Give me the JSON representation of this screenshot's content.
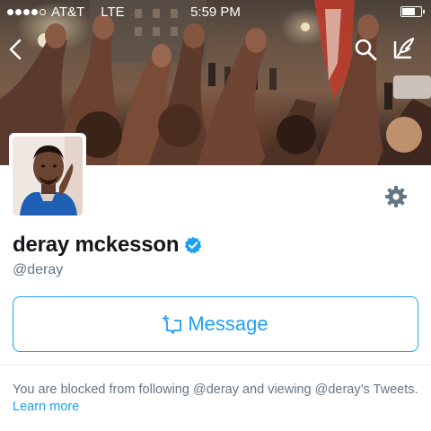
{
  "status_bar": {
    "carrier": "AT&T",
    "network": "LTE",
    "time": "5:59 PM",
    "signal_dots": 5,
    "signal_filled": 4,
    "battery_level": 0.75
  },
  "header": {
    "back_icon": "chevron-left-icon",
    "search_icon": "search-icon",
    "compose_icon": "compose-tweet-icon"
  },
  "profile": {
    "display_name": "deray mckesson",
    "verified": true,
    "handle": "@deray",
    "settings_icon": "gear-icon"
  },
  "message_button": {
    "label": "Message",
    "icon": "direct-message-icon"
  },
  "notice": {
    "text": "You are blocked from following @deray and viewing @deray’s Tweets.",
    "link": "Learn more"
  },
  "colors": {
    "accent": "#1da1f2",
    "secondary_text": "#657786",
    "primary_text": "#14171a",
    "divider": "#e6ecf0"
  }
}
